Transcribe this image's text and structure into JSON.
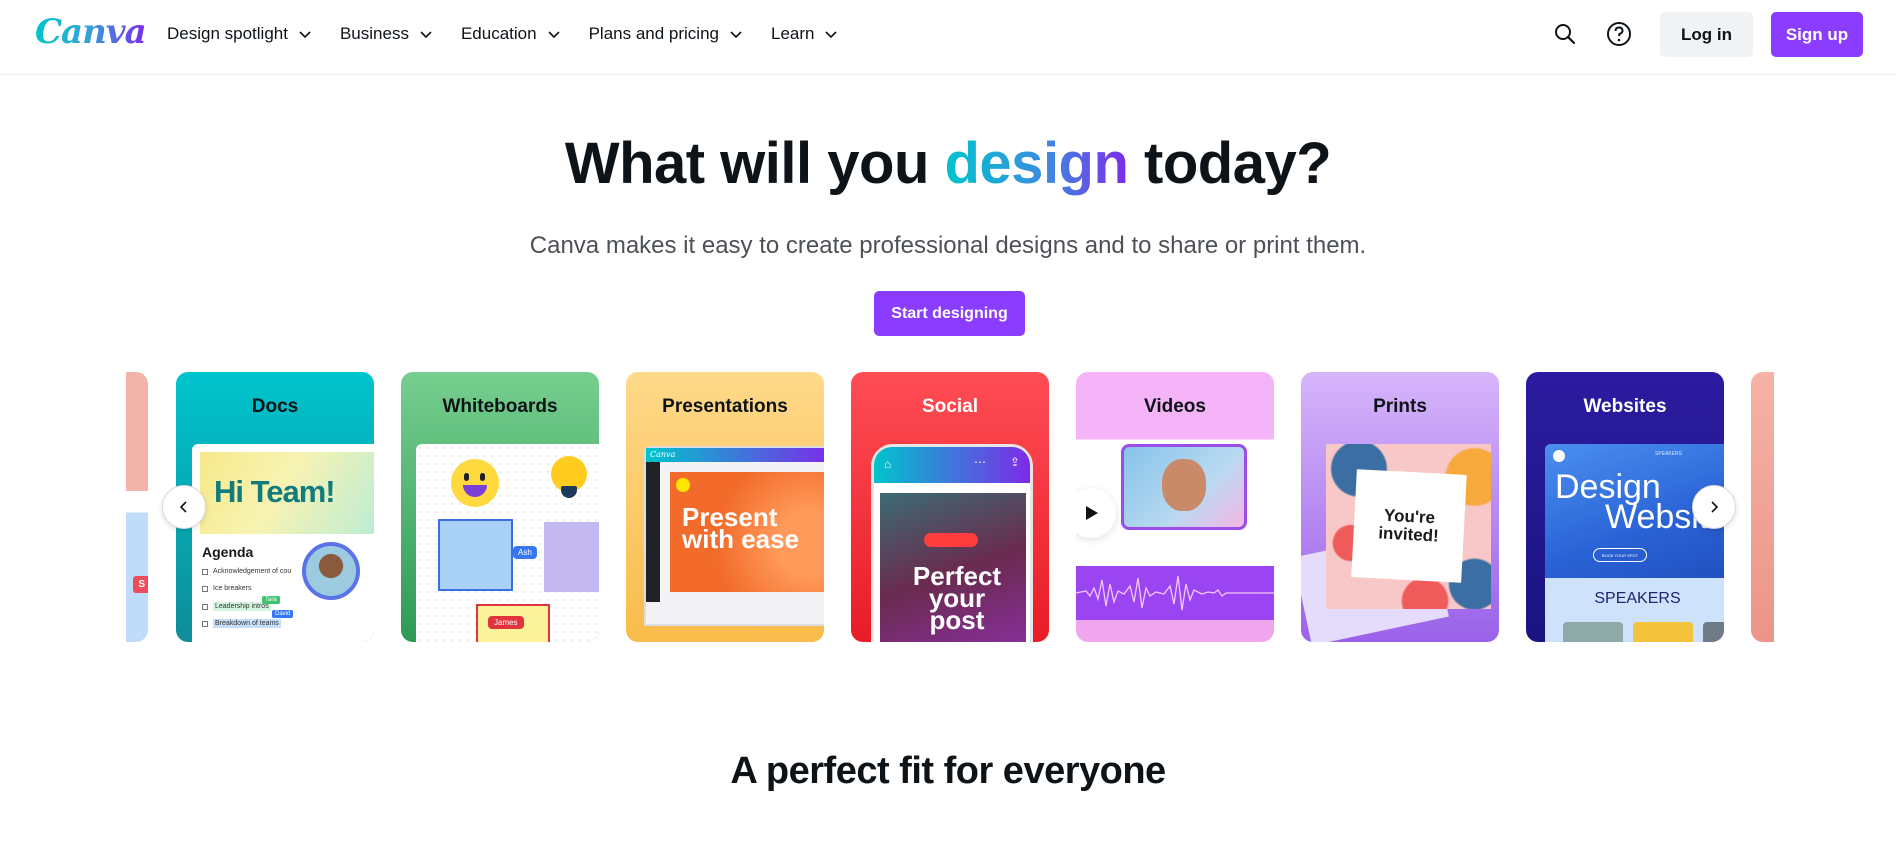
{
  "header": {
    "logo": "Canva",
    "nav": [
      {
        "label": "Design spotlight"
      },
      {
        "label": "Business"
      },
      {
        "label": "Education"
      },
      {
        "label": "Plans and pricing"
      },
      {
        "label": "Learn"
      }
    ],
    "search_icon": "search-icon",
    "help_icon": "help-circle-icon",
    "login_label": "Log in",
    "signup_label": "Sign up"
  },
  "hero": {
    "title_before": "What will you ",
    "title_accent": "design",
    "title_after": " today?",
    "subtitle": "Canva makes it easy to create professional designs and to share or print them.",
    "cta_label": "Start designing"
  },
  "carousel": {
    "prev_icon": "chevron-left-icon",
    "next_icon": "chevron-right-icon",
    "cards": [
      {
        "label": "Docs"
      },
      {
        "label": "Whiteboards"
      },
      {
        "label": "Presentations"
      },
      {
        "label": "Social"
      },
      {
        "label": "Videos"
      },
      {
        "label": "Prints"
      },
      {
        "label": "Websites"
      }
    ],
    "docs_art": {
      "headline": "Hi Team!",
      "agenda_title": "Agenda",
      "items": [
        "Acknowledgement of cou",
        "Ice breakers",
        "Leadership intros",
        "Breakdown of teams"
      ],
      "tags": [
        "Tara",
        "David"
      ]
    },
    "whiteboard_art": {
      "tags": [
        "Ash",
        "James"
      ]
    },
    "presentation_art": {
      "app_label": "Canva",
      "headline_1": "Present",
      "headline_2": "with ease"
    },
    "social_art": {
      "headline_1": "Perfect",
      "headline_2": "your",
      "headline_3": "post"
    },
    "prints_art": {
      "headline_1": "You're",
      "headline_2": "invited!"
    },
    "websites_art": {
      "headline_1": "Design",
      "headline_2": "Websit",
      "button": "BOOK YOUR SPOT",
      "section": "SPEAKERS",
      "nav_item": "SPEAKERS"
    },
    "partial_left_badge": "S"
  },
  "section": {
    "title": "A perfect fit for everyone"
  },
  "colors": {
    "brand_purple": "#8b3dff",
    "brand_teal": "#00c4cc",
    "text_dark": "#0e1318",
    "text_muted": "#4d5156"
  }
}
